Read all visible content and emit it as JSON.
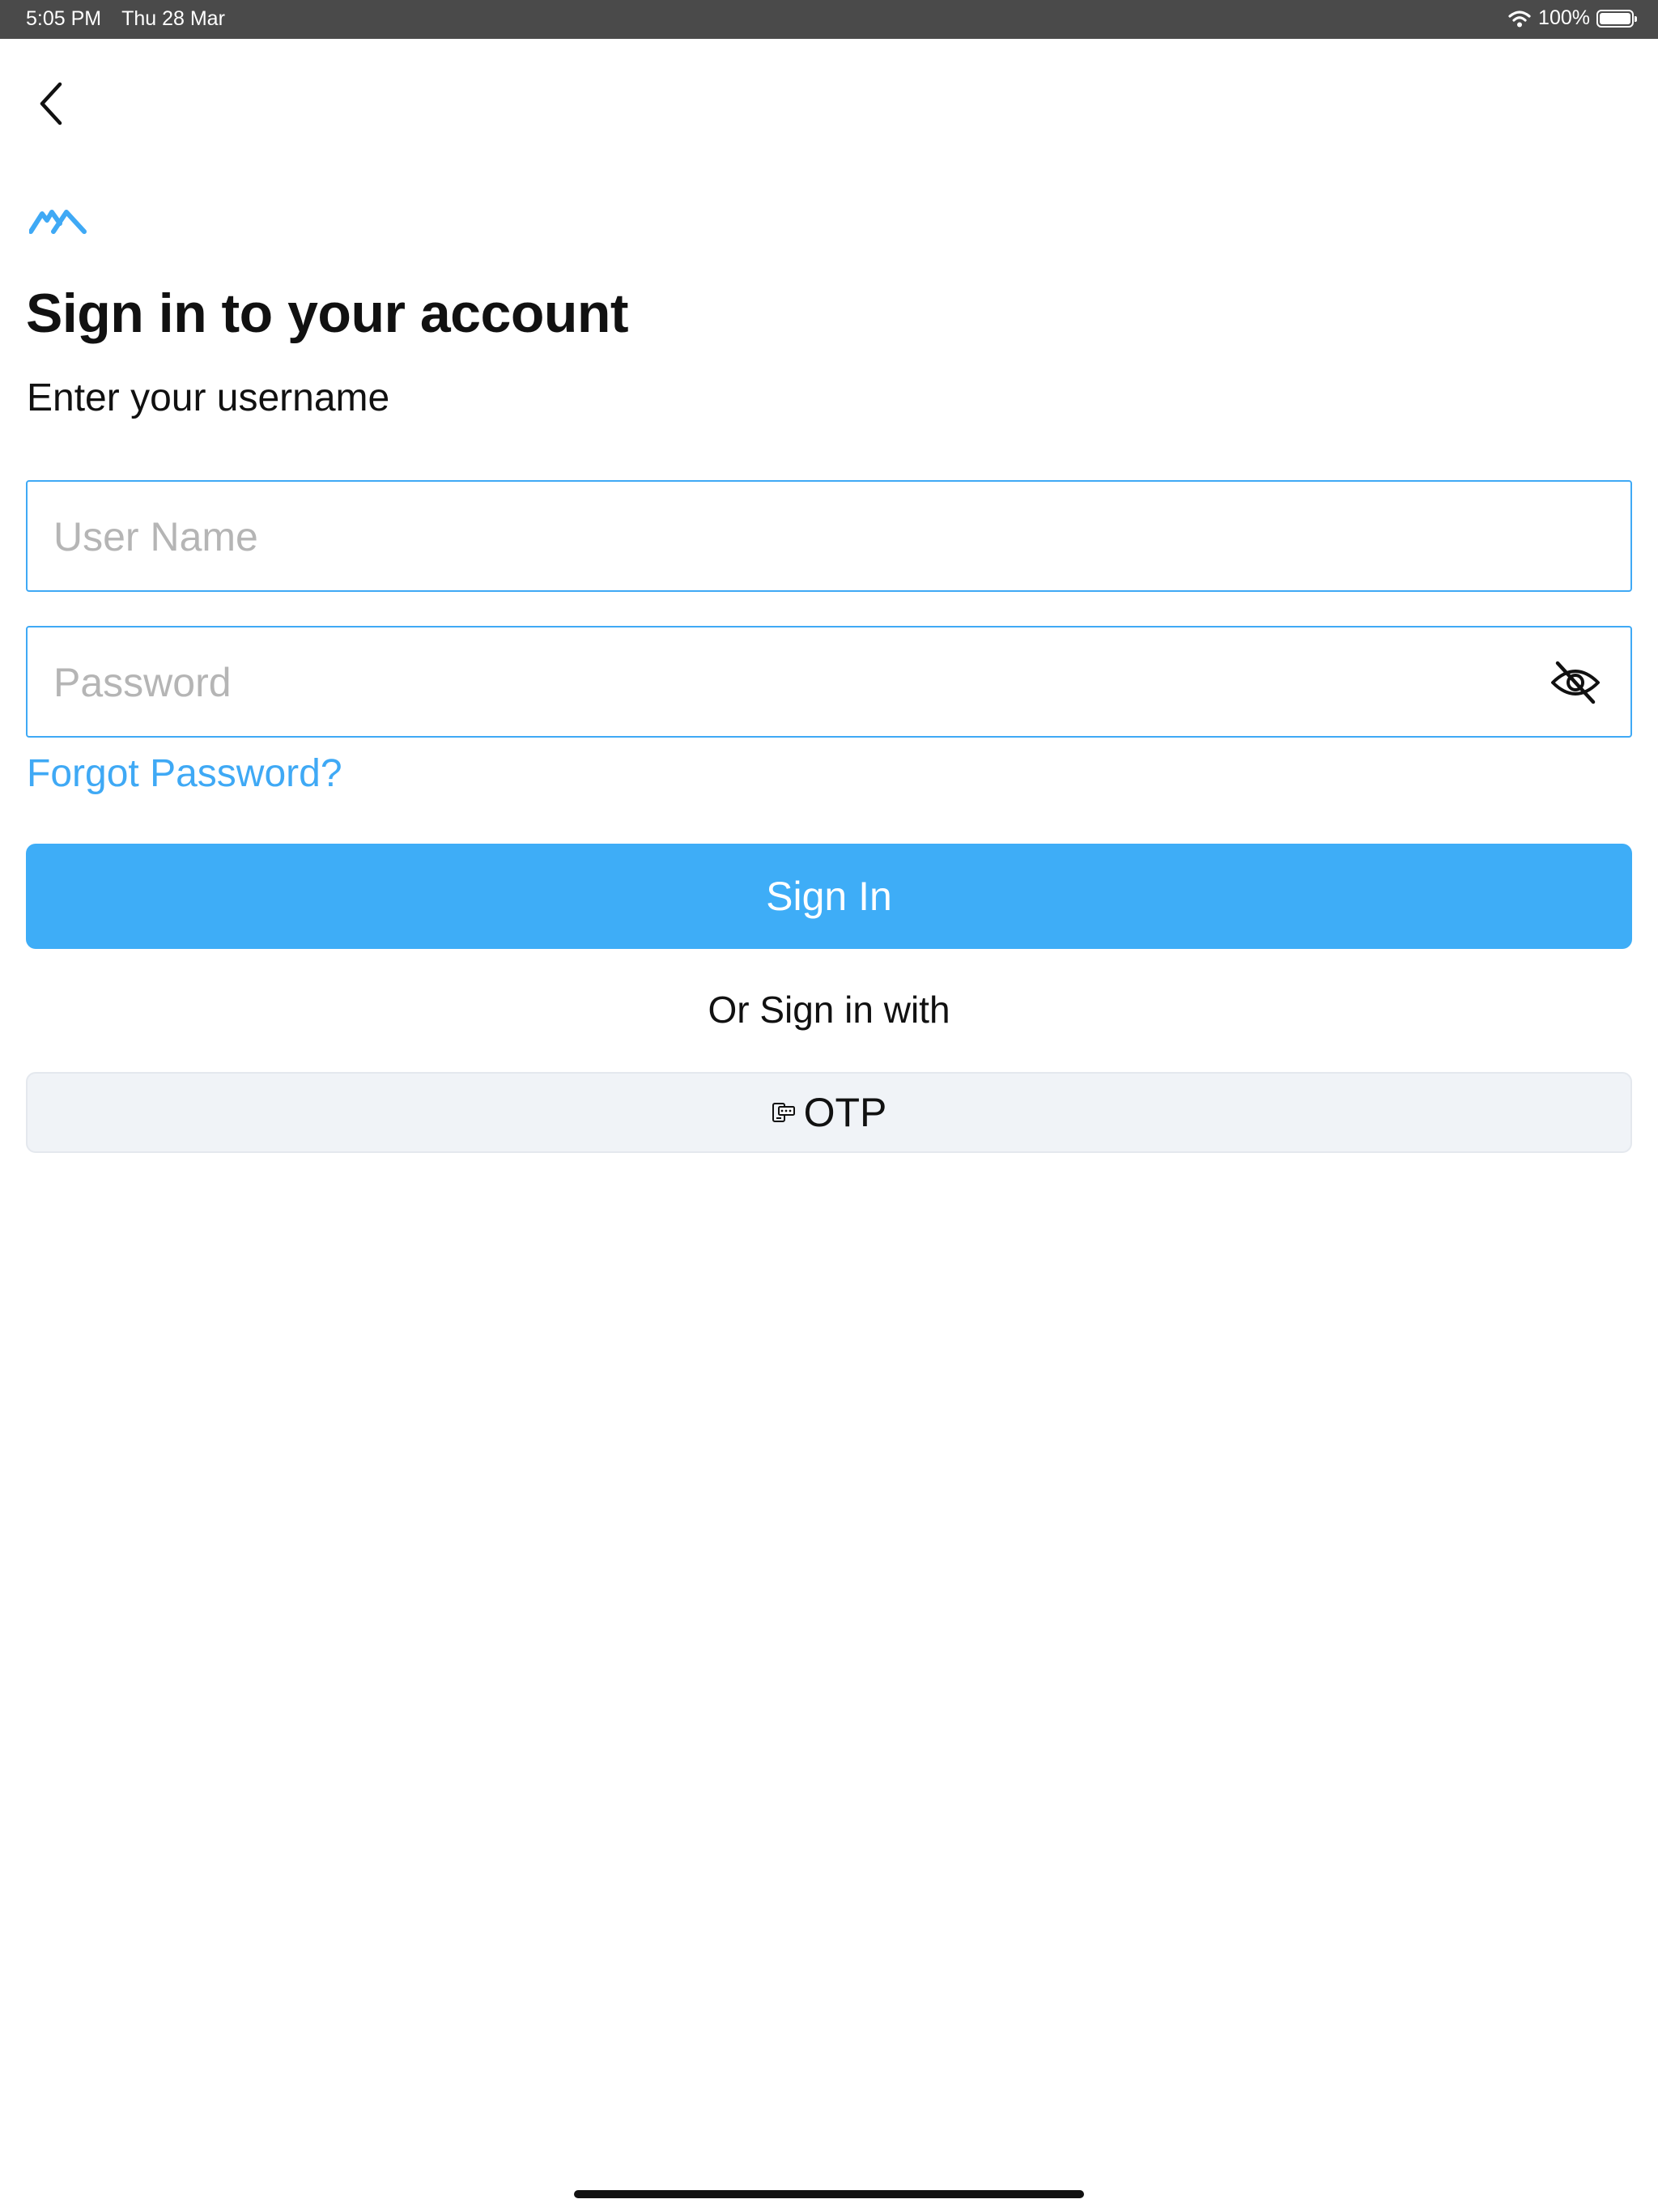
{
  "status_bar": {
    "time": "5:05 PM",
    "date": "Thu 28 Mar",
    "battery": "100%",
    "battery_level": 1.0,
    "icons": [
      "wifi-icon",
      "battery-icon"
    ]
  },
  "nav": {
    "back_icon": "chevron-left-icon"
  },
  "logo": {
    "icon": "brand-logo",
    "color": "#3fa9f5"
  },
  "header": {
    "title": "Sign in to your account",
    "subtitle": "Enter your username"
  },
  "form": {
    "username": {
      "value": "",
      "placeholder": "User Name"
    },
    "password": {
      "value": "",
      "placeholder": "Password",
      "toggle_icon": "eye-off-icon"
    },
    "forgot_label": "Forgot Password?",
    "signin_label": "Sign In"
  },
  "alt_signin": {
    "label": "Or Sign in with",
    "otp_label": "OTP",
    "otp_icon": "keypad-phone-icon"
  },
  "colors": {
    "accent": "#3fa9f5",
    "button": "#3eadf7",
    "secondary_button_bg": "#f0f3f7",
    "status_bar": "#4a4a4a"
  }
}
